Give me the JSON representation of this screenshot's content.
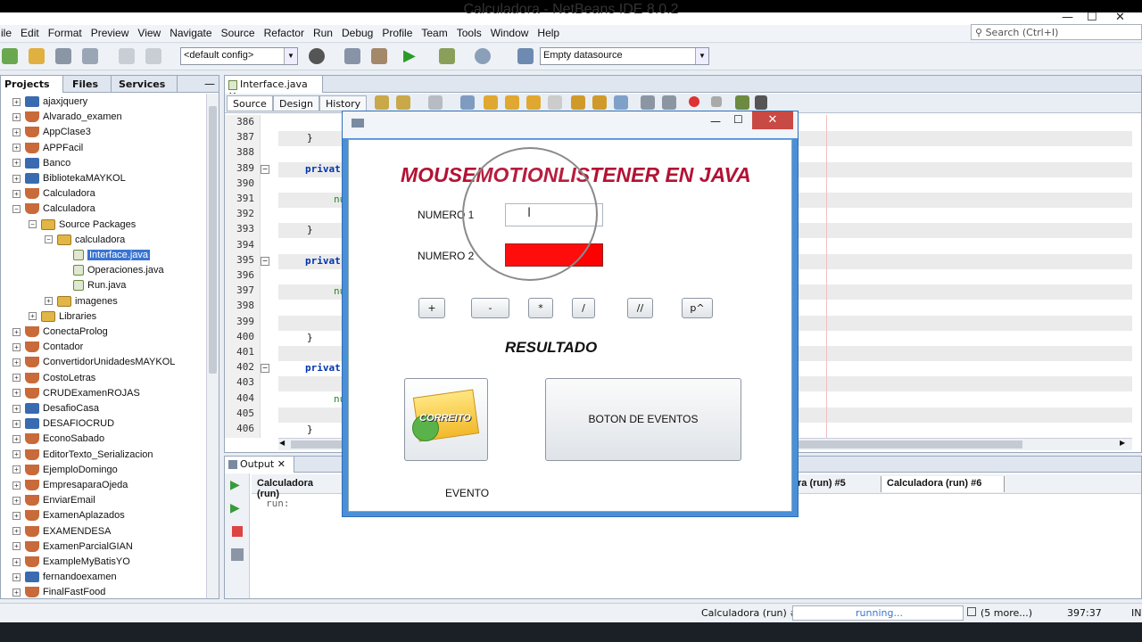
{
  "window": {
    "title": "Calculadora - NetBeans IDE 8.0.2"
  },
  "menu": [
    "ile",
    "Edit",
    "Format",
    "Preview",
    "View",
    "Navigate",
    "Source",
    "Refactor",
    "Run",
    "Debug",
    "Profile",
    "Team",
    "Tools",
    "Window",
    "Help"
  ],
  "search": {
    "placeholder": "Search (Ctrl+I)"
  },
  "toolbar": {
    "config": "<default config>",
    "datasource": "Empty datasource"
  },
  "projects": {
    "tabs": [
      "Projects",
      "Files",
      "Services"
    ],
    "items": [
      {
        "label": "ajaxjquery",
        "level": 0,
        "icon": "web-project-icon"
      },
      {
        "label": "Alvarado_examen",
        "level": 0,
        "icon": "java-project-icon"
      },
      {
        "label": "AppClase3",
        "level": 0,
        "icon": "java-project-icon"
      },
      {
        "label": "APPFacil",
        "level": 0,
        "icon": "java-project-icon"
      },
      {
        "label": "Banco",
        "level": 0,
        "icon": "web-project-icon"
      },
      {
        "label": "BibliotekaMAYKOL",
        "level": 0,
        "icon": "web-project-icon"
      },
      {
        "label": "Calculadora",
        "level": 0,
        "icon": "java-project-icon"
      },
      {
        "label": "Calculadora",
        "level": 0,
        "icon": "java-project-icon",
        "expanded": true
      },
      {
        "label": "Source Packages",
        "level": 1,
        "icon": "package-folder-icon",
        "expanded": true
      },
      {
        "label": "calculadora",
        "level": 2,
        "icon": "package-icon",
        "expanded": true
      },
      {
        "label": "Interface.java",
        "level": 3,
        "icon": "java-file-icon",
        "selected": true
      },
      {
        "label": "Operaciones.java",
        "level": 3,
        "icon": "java-file-icon"
      },
      {
        "label": "Run.java",
        "level": 3,
        "icon": "java-file-icon"
      },
      {
        "label": "imagenes",
        "level": 2,
        "icon": "package-icon"
      },
      {
        "label": "Libraries",
        "level": 1,
        "icon": "library-folder-icon"
      },
      {
        "label": "ConectaProlog",
        "level": 0,
        "icon": "java-project-icon"
      },
      {
        "label": "Contador",
        "level": 0,
        "icon": "java-project-icon"
      },
      {
        "label": "ConvertidorUnidadesMAYKOL",
        "level": 0,
        "icon": "java-project-icon"
      },
      {
        "label": "CostoLetras",
        "level": 0,
        "icon": "java-project-icon"
      },
      {
        "label": "CRUDExamenROJAS",
        "level": 0,
        "icon": "java-project-icon"
      },
      {
        "label": "DesafioCasa",
        "level": 0,
        "icon": "web-project-icon"
      },
      {
        "label": "DESAFIOCRUD",
        "level": 0,
        "icon": "web-project-icon"
      },
      {
        "label": "EconoSabado",
        "level": 0,
        "icon": "java-project-icon"
      },
      {
        "label": "EditorTexto_Serializacion",
        "level": 0,
        "icon": "java-project-icon"
      },
      {
        "label": "EjemploDomingo",
        "level": 0,
        "icon": "java-project-icon"
      },
      {
        "label": "EmpresaparaOjeda",
        "level": 0,
        "icon": "java-project-icon"
      },
      {
        "label": "EnviarEmail",
        "level": 0,
        "icon": "java-project-icon"
      },
      {
        "label": "ExamenAplazados",
        "level": 0,
        "icon": "java-project-icon"
      },
      {
        "label": "EXAMENDESA",
        "level": 0,
        "icon": "java-project-icon"
      },
      {
        "label": "ExamenParcialGIAN",
        "level": 0,
        "icon": "java-project-icon"
      },
      {
        "label": "ExampleMyBatisYO",
        "level": 0,
        "icon": "java-project-icon"
      },
      {
        "label": "fernandoexamen",
        "level": 0,
        "icon": "web-project-icon"
      },
      {
        "label": "FinalFastFood",
        "level": 0,
        "icon": "java-project-icon"
      }
    ]
  },
  "editor": {
    "tab": "Interface.java",
    "subtabs": [
      "Source",
      "Design",
      "History"
    ],
    "lines": [
      {
        "n": "386",
        "code": "",
        "fold": false
      },
      {
        "n": "387",
        "code": "}",
        "fold": false
      },
      {
        "n": "388",
        "code": "",
        "fold": false
      },
      {
        "n": "389",
        "code": "privat",
        "fold": true
      },
      {
        "n": "390",
        "code": "",
        "fold": false
      },
      {
        "n": "391",
        "code": "nu",
        "fold": false
      },
      {
        "n": "392",
        "code": "",
        "fold": false
      },
      {
        "n": "393",
        "code": "}",
        "fold": false
      },
      {
        "n": "394",
        "code": "",
        "fold": false
      },
      {
        "n": "395",
        "code": "privat",
        "fold": true
      },
      {
        "n": "396",
        "code": "",
        "fold": false
      },
      {
        "n": "397",
        "code": "nu",
        "fold": false
      },
      {
        "n": "398",
        "code": "",
        "fold": false
      },
      {
        "n": "399",
        "code": "",
        "fold": false
      },
      {
        "n": "400",
        "code": "}",
        "fold": false
      },
      {
        "n": "401",
        "code": "",
        "fold": false
      },
      {
        "n": "402",
        "code": "privat",
        "fold": true
      },
      {
        "n": "403",
        "code": "",
        "fold": false
      },
      {
        "n": "404",
        "code": "nu",
        "fold": false
      },
      {
        "n": "405",
        "code": "",
        "fold": false
      },
      {
        "n": "406",
        "code": "}",
        "fold": false
      }
    ]
  },
  "output": {
    "tab": "Output",
    "runtabs": [
      "Calculadora (run)",
      "ra (run) #5",
      "Calculadora (run) #6"
    ],
    "text": "run:"
  },
  "status": {
    "task": "Calculadora (run) #6",
    "progress": "running...",
    "more": "(5 more...)",
    "position": "397:37",
    "ins": "IN"
  },
  "dialog": {
    "heading": "MOUSEMOTIONLISTENER EN JAVA",
    "label1": "NUMERO 1",
    "label2": "NUMERO 2",
    "ops": [
      "+",
      "-",
      "*",
      "/",
      "//",
      "p^"
    ],
    "result": "RESULTADO",
    "image_text": "CORREITO",
    "event_button": "BOTON DE EVENTOS",
    "event_label": "EVENTO",
    "close": "✕",
    "colors": {
      "heading": "#b31234",
      "field2": "#ff0000"
    }
  }
}
